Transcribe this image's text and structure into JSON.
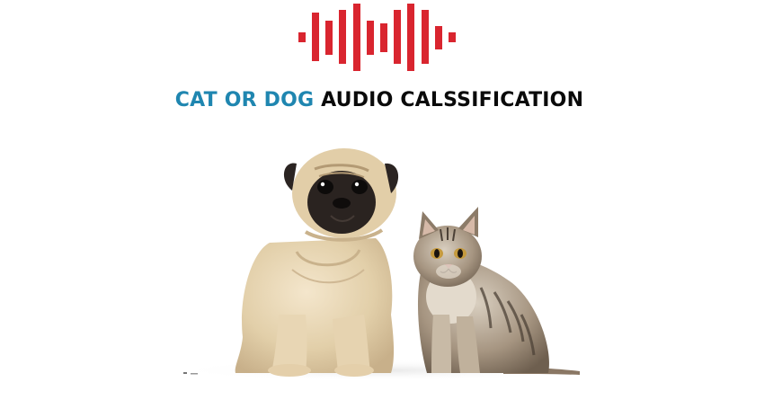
{
  "header": {
    "title_highlight": "CAT OR DOG",
    "title_rest": "AUDIO CALSSIFICATION"
  },
  "logo": {
    "icon": "audio-waveform-icon",
    "color": "#d9252f"
  },
  "hero": {
    "icon": "pug-and-kitten-illustration"
  },
  "colors": {
    "accent": "#1f86b0",
    "text": "#0a0a0a",
    "background": "#ffffff"
  }
}
